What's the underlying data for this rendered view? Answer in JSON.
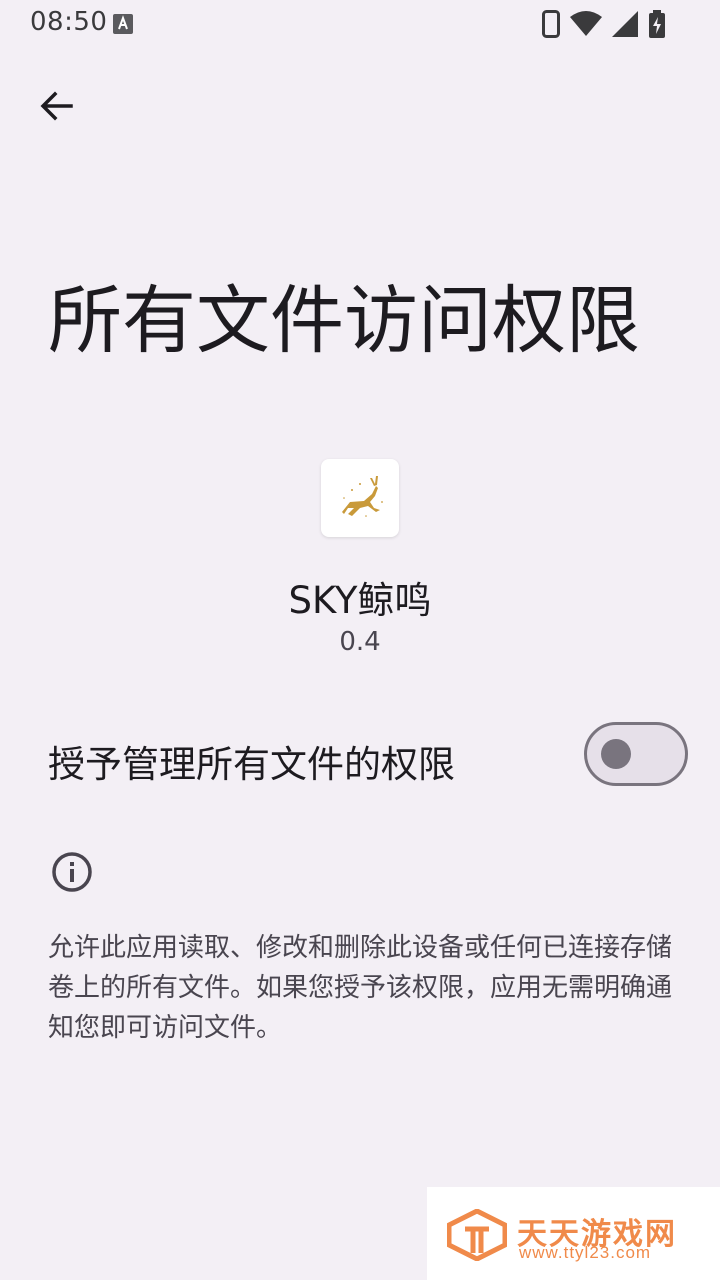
{
  "status_bar": {
    "time": "08:50"
  },
  "page": {
    "title": "所有文件访问权限"
  },
  "app": {
    "name": "SKY鲸鸣",
    "version": "0.4"
  },
  "toggle": {
    "label": "授予管理所有文件的权限",
    "enabled": false
  },
  "info": {
    "description": "允许此应用读取、修改和删除此设备或任何已连接存储卷上的所有文件。如果您授予该权限，应用无需明确通知您即可访问文件。"
  },
  "watermark": {
    "name": "天天游戏网",
    "url": "www.ttyl23.com"
  },
  "colors": {
    "background": "#f3eff5",
    "switch_outline": "#79747e",
    "watermark": "#f08a4a"
  }
}
